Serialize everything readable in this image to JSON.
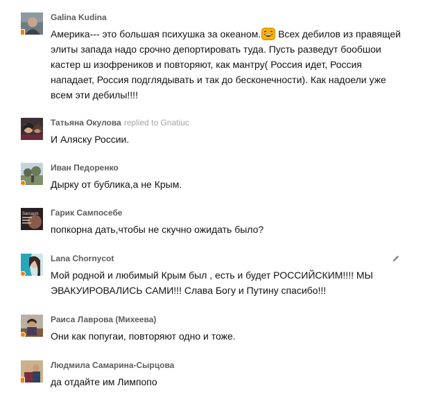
{
  "comments": [
    {
      "author": "Galina Kudina",
      "reply_to": "",
      "text_before": "Америка--- это большая психушка за океаном.",
      "emoticon": "laughing-smiley-icon",
      "text_after": " Всех дебилов из правящей элиты запада надо срочно депортировать туда. Пусть разведут бообшои кастер ш изофреников и повторяют, как мантру( Россия идет, Россия нападает, Россия подглядывать и так до бесконечности).  Как надоели уже всем эти дебилы!!!!",
      "status": "mobile"
    },
    {
      "author": "Татьяна Окулова",
      "reply_to": "replied to Gnatiuc",
      "text_before": "И Аляску России.",
      "status": "none"
    },
    {
      "author": "Иван Педоренко",
      "reply_to": "",
      "text_before": "Дырку от бублика,а не Крым.",
      "status": "online"
    },
    {
      "author": "Гарик Сампосебе",
      "reply_to": "",
      "text_before": "попкорна дать,чтобы не скучно ожидать было?",
      "avatar_caption": "Sarcasm",
      "status": "none"
    },
    {
      "author": "Lana Chornycot",
      "reply_to": "",
      "text_before": "Мой родной и любимый Крым был , есть и будет РОССИЙСКИМ!!!! МЫ ЭВАКУИРОВАЛИСЬ САМИ!!! Слава Богу и Путину спасибо!!!",
      "status": "online",
      "action_icon": "pencil-icon"
    },
    {
      "author": "Раиса Лаврова (Михеева)",
      "reply_to": "",
      "text_before": "Они как попугаи, повторяют одно и тоже.",
      "status": "online"
    },
    {
      "author": "Людмила Самарина-Сырцова",
      "reply_to": "",
      "text_before": "да отдайте им Лимпопо",
      "status": "mobile"
    }
  ],
  "colors": {
    "author": "#5c5c5c",
    "reply": "#a4a4a4",
    "text": "#111111",
    "status": "#ee8208"
  }
}
